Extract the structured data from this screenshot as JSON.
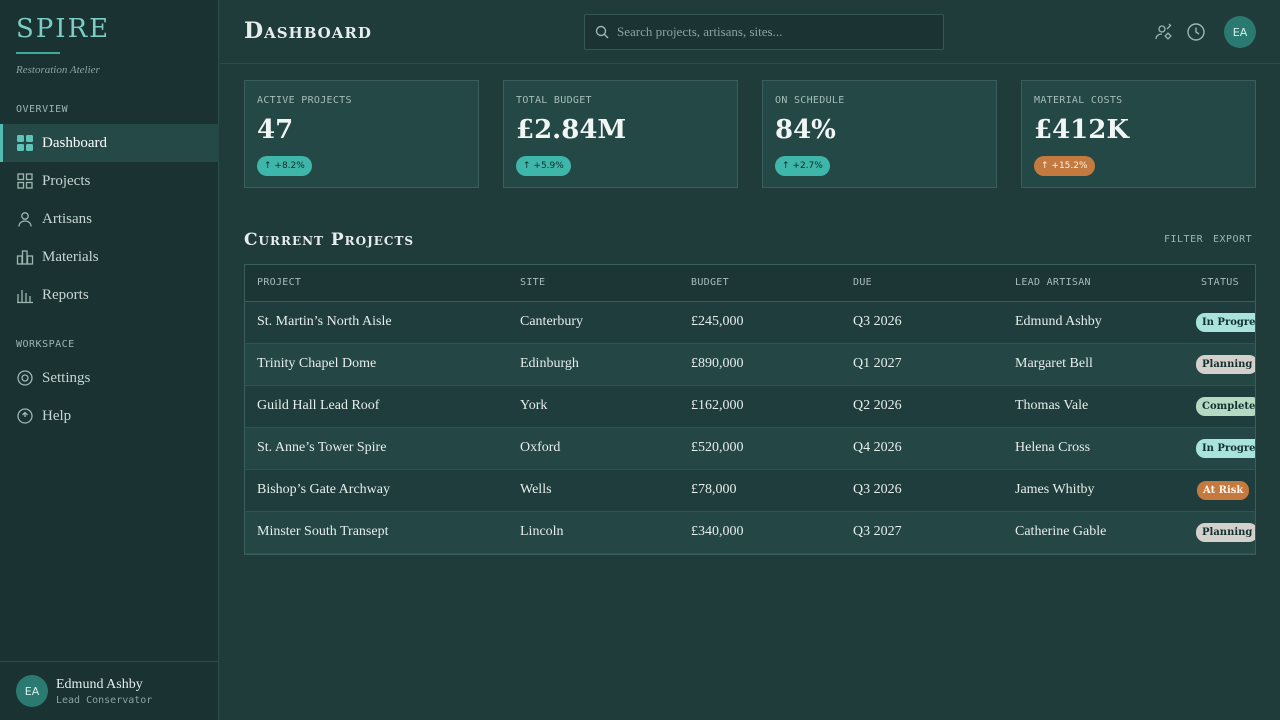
{
  "brand": {
    "name": "SPIRE",
    "tagline": "Restoration Atelier"
  },
  "sidebar": {
    "sections": [
      {
        "title": "OVERVIEW"
      },
      {
        "title": "WORKSPACE"
      }
    ],
    "items": [
      {
        "label": "Dashboard",
        "icon": "grid-icon"
      },
      {
        "label": "Projects",
        "icon": "squares-icon"
      },
      {
        "label": "Artisans",
        "icon": "person-icon"
      },
      {
        "label": "Materials",
        "icon": "blocks-icon"
      },
      {
        "label": "Reports",
        "icon": "bar-chart-icon"
      },
      {
        "label": "Settings",
        "icon": "gear-icon"
      },
      {
        "label": "Help",
        "icon": "help-icon"
      }
    ],
    "user": {
      "initials": "EA",
      "name": "Edmund Ashby",
      "role": "Lead Conservator"
    }
  },
  "header": {
    "title": "Dashboard",
    "search_placeholder": "Search projects, artisans, sites...",
    "avatar_initials": "EA"
  },
  "stats": [
    {
      "label": "ACTIVE PROJECTS",
      "value": "47",
      "change": "↑ +8.2%",
      "color": "#3fb6aa"
    },
    {
      "label": "TOTAL BUDGET",
      "value": "£2.84M",
      "change": "↑ +5.9%",
      "color": "#3fb6aa"
    },
    {
      "label": "ON SCHEDULE",
      "value": "84%",
      "change": "↑ +2.7%",
      "color": "#3fb6aa"
    },
    {
      "label": "MATERIAL COSTS",
      "value": "£412K",
      "change": "↑ +15.2%",
      "color": "#c47a3e"
    }
  ],
  "projects": {
    "title": "Current Projects",
    "actions": {
      "filter": "FILTER",
      "export": "EXPORT"
    },
    "columns": [
      "PROJECT",
      "SITE",
      "BUDGET",
      "DUE",
      "LEAD ARTISAN",
      "STATUS"
    ],
    "rows": [
      {
        "project": "St. Martin’s North Aisle",
        "site": "Canterbury",
        "budget": "£245,000",
        "due": "Q3 2026",
        "lead": "Edmund Ashby",
        "status": "In Progress",
        "status_color": "#a8e3dc"
      },
      {
        "project": "Trinity Chapel Dome",
        "site": "Edinburgh",
        "budget": "£890,000",
        "due": "Q1 2027",
        "lead": "Margaret Bell",
        "status": "Planning",
        "status_color": "#d4d0cc"
      },
      {
        "project": "Guild Hall Lead Roof",
        "site": "York",
        "budget": "£162,000",
        "due": "Q2 2026",
        "lead": "Thomas Vale",
        "status": "Complete",
        "status_color": "#b5d9c2"
      },
      {
        "project": "St. Anne’s Tower Spire",
        "site": "Oxford",
        "budget": "£520,000",
        "due": "Q4 2026",
        "lead": "Helena Cross",
        "status": "In Progress",
        "status_color": "#a8e3dc"
      },
      {
        "project": "Bishop’s Gate Archway",
        "site": "Wells",
        "budget": "£78,000",
        "due": "Q3 2026",
        "lead": "James Whitby",
        "status": "At Risk",
        "status_color": "#c47a3e"
      },
      {
        "project": "Minster South Transept",
        "site": "Lincoln",
        "budget": "£340,000",
        "due": "Q3 2027",
        "lead": "Catherine Gable",
        "status": "Planning",
        "status_color": "#d4d0cc"
      }
    ]
  }
}
